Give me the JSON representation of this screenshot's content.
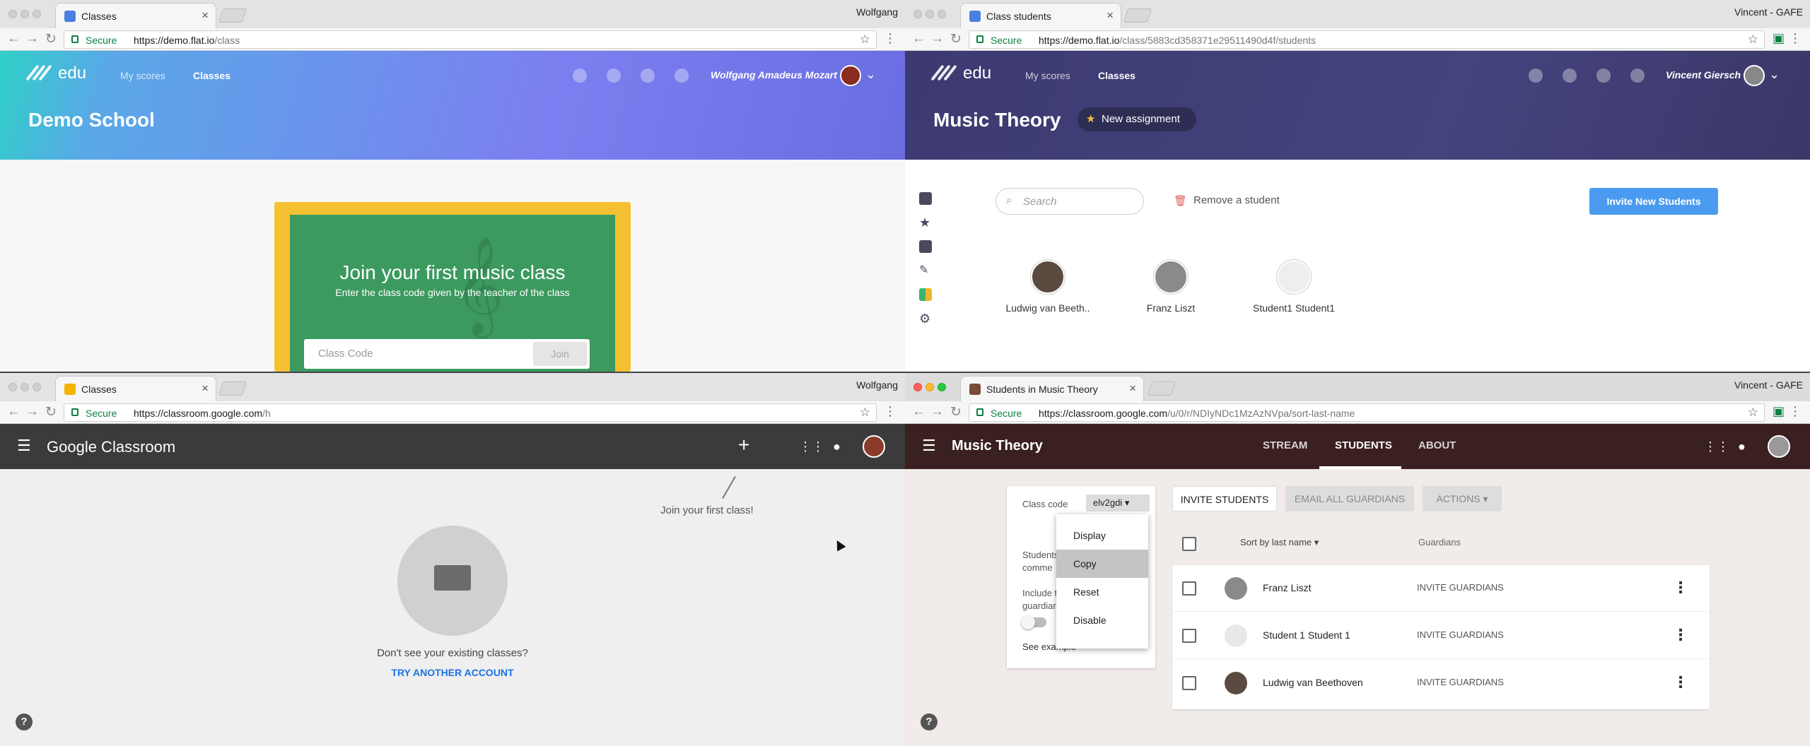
{
  "windows": {
    "w1": {
      "tab_title": "Classes",
      "profile": "Wolfgang",
      "secure": "Secure",
      "url_host": "https://demo.flat.io",
      "url_path": "/class",
      "logo": "edu",
      "nav": [
        "My scores",
        "Classes"
      ],
      "user_name": "Wolfgang Amadeus Mozart",
      "school_title": "Demo School",
      "join_title": "Join your first music class",
      "join_subtitle": "Enter the class code given by the teacher of the class",
      "code_placeholder": "Class Code",
      "join_button": "Join"
    },
    "w2": {
      "tab_title": "Class students",
      "profile": "Vincent - GAFE",
      "secure": "Secure",
      "url_host": "https://demo.flat.io",
      "url_path": "/class/5883cd358371e29511490d4f/students",
      "logo": "edu",
      "nav": [
        "My scores",
        "Classes"
      ],
      "user_name": "Vincent Giersch",
      "class_title": "Music Theory",
      "new_assignment": "New assignment",
      "search_placeholder": "Search",
      "remove_student": "Remove a student",
      "invite_button": "Invite New Students",
      "students": [
        "Ludwig van Beeth..",
        "Franz Liszt",
        "Student1 Student1"
      ]
    },
    "w3": {
      "tab_title": "Classes",
      "profile": "Wolfgang",
      "secure": "Secure",
      "url_host": "https://classroom.google.com",
      "url_path": "/h",
      "logo": "Google Classroom",
      "join_first": "Join your first class!",
      "dont_see": "Don't see your existing classes?",
      "try_another": "TRY ANOTHER ACCOUNT"
    },
    "w4": {
      "tab_title": "Students in Music Theory",
      "profile": "Vincent - GAFE",
      "secure": "Secure",
      "url_host": "https://classroom.google.com",
      "url_path": "/u/0/r/NDIyNDc1MzAzNVpa/sort-last-name",
      "class_title": "Music Theory",
      "tabs": [
        "STREAM",
        "STUDENTS",
        "ABOUT"
      ],
      "class_code_label": "Class code",
      "class_code": "elv2gdi",
      "side_text_1a": "Students",
      "side_text_1b": "comme",
      "side_text_2a": "Include t",
      "side_text_2b": "guardian",
      "see_example": "See example",
      "menu": [
        "Display",
        "Copy",
        "Reset",
        "Disable"
      ],
      "invite_students": "INVITE STUDENTS",
      "email_guardians": "EMAIL ALL GUARDIANS",
      "actions": "ACTIONS",
      "sort_label": "Sort by last name",
      "guardians_label": "Guardians",
      "rows": [
        {
          "name": "Franz Liszt",
          "guardian": "INVITE GUARDIANS"
        },
        {
          "name": "Student 1 Student 1",
          "guardian": "INVITE GUARDIANS"
        },
        {
          "name": "Ludwig van Beethoven",
          "guardian": "INVITE GUARDIANS"
        }
      ]
    }
  },
  "colors": {
    "flat_gradient_1": "#2fd0c7",
    "flat_gradient_2": "#7b7ff0",
    "flat_dark": "#3c3a70",
    "classroom_dark": "#3a2020",
    "accent_blue": "#4a9bf0"
  }
}
